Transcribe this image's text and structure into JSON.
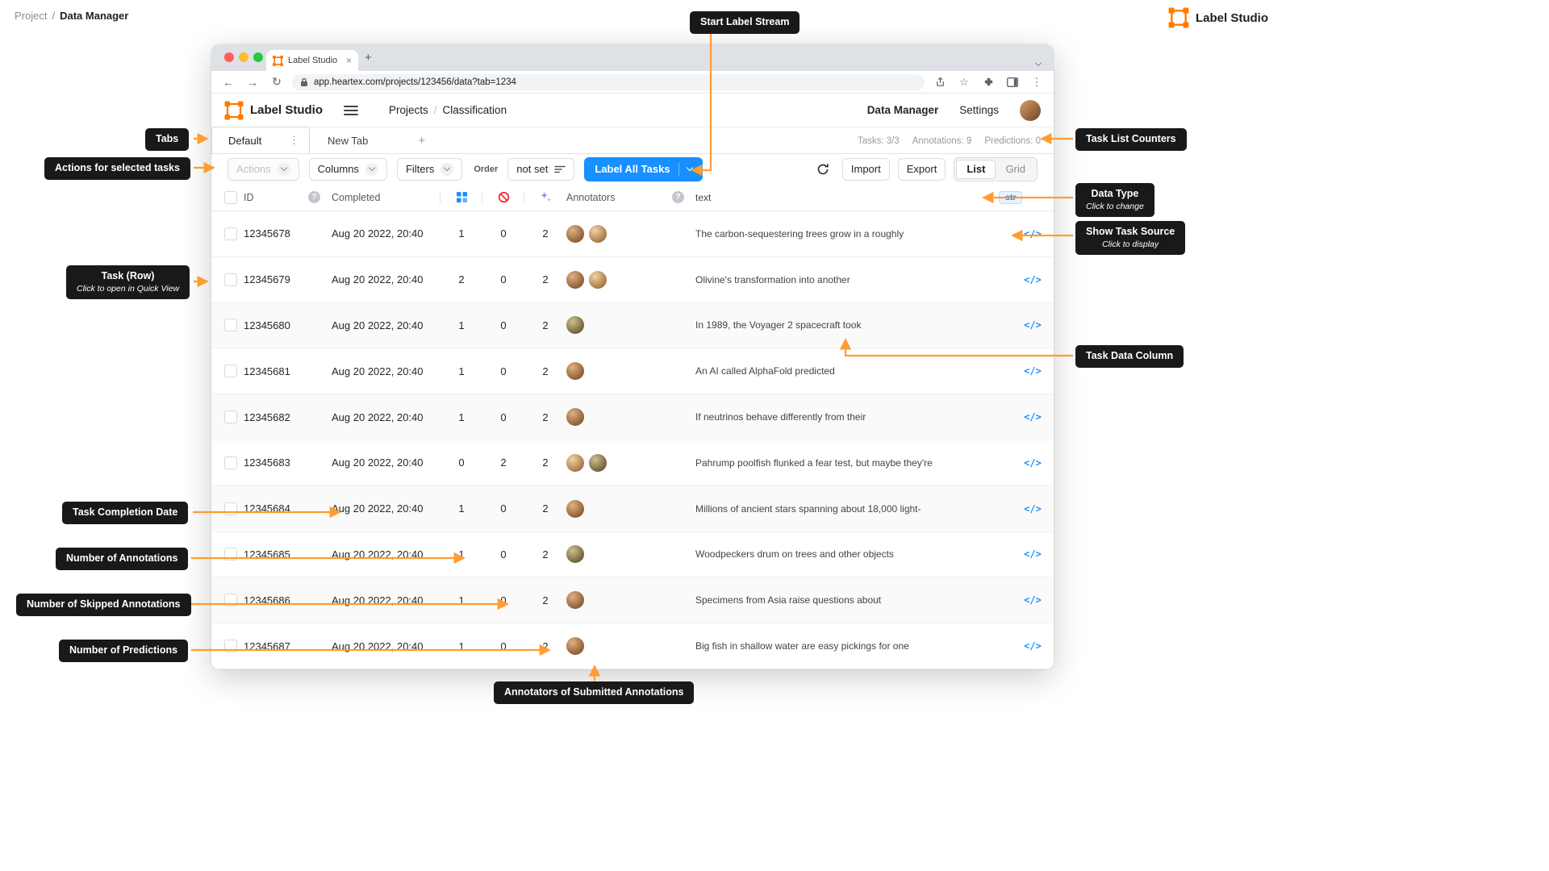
{
  "colors": {
    "accent_orange": "#FF9C32",
    "primary_blue": "#1890FF",
    "callout_bg": "#191919",
    "brand_orange": "#FF7A00"
  },
  "icons": {
    "kebab": "⋮",
    "plus": "+",
    "close": "×",
    "back": "←",
    "forward": "→",
    "reload": "↻",
    "star": "☆",
    "code": "</>",
    "question": "?"
  },
  "page": {
    "breadcrumb": {
      "root": "Project",
      "sep": "/",
      "current": "Data Manager"
    },
    "brand": "Label Studio"
  },
  "callouts": {
    "start_label_stream": "Start Label Stream",
    "tabs": "Tabs",
    "actions_for_selected": "Actions for selected tasks",
    "task_row": {
      "title": "Task (Row)",
      "sub": "Click to open in Quick View"
    },
    "task_completion_date": "Task Completion Date",
    "number_of_annotations": "Number of Annotations",
    "number_of_skipped": "Number of Skipped Annotations",
    "number_of_predictions": "Number of Predictions",
    "task_list_counters": "Task List Counters",
    "data_type": {
      "title": "Data Type",
      "sub": "Click to change"
    },
    "show_task_source": {
      "title": "Show Task Source",
      "sub": "Click to display"
    },
    "task_data_column": "Task Data Column",
    "annotators_submitted": "Annotators of Submitted Annotations"
  },
  "browser": {
    "tab_title": "Label Studio",
    "url": "app.heartex.com/projects/123456/data?tab=1234"
  },
  "app": {
    "brand": "Label Studio",
    "breadcrumb": {
      "root": "Projects",
      "sep": "/",
      "current": "Classification"
    },
    "nav": {
      "data_manager": "Data Manager",
      "settings": "Settings"
    },
    "tabs": {
      "active": "Default",
      "inactive": "New Tab"
    },
    "counters": {
      "tasks": "Tasks: 3/3",
      "annotations": "Annotations: 9",
      "predictions": "Predictions: 0"
    },
    "toolbar": {
      "actions": "Actions",
      "columns": "Columns",
      "filters": "Filters",
      "order_label": "Order",
      "order_value": "not set",
      "label_all_tasks": "Label All Tasks",
      "import": "Import",
      "export": "Export",
      "view_list": "List",
      "view_grid": "Grid"
    },
    "table": {
      "headers": {
        "id": "ID",
        "completed": "Completed",
        "annotators": "Annotators",
        "text": "text"
      },
      "data_type_badge": "str",
      "rows": [
        {
          "id": "12345678",
          "completed": "Aug 20 2022, 20:40",
          "annotations": "1",
          "skipped": "0",
          "predictions": "2",
          "annotators_count": 2,
          "text": "The carbon-sequestering trees grow in a roughly"
        },
        {
          "id": "12345679",
          "completed": "Aug 20 2022, 20:40",
          "annotations": "2",
          "skipped": "0",
          "predictions": "2",
          "annotators_count": 2,
          "text": "Olivine's transformation into another"
        },
        {
          "id": "12345680",
          "completed": "Aug 20 2022, 20:40",
          "annotations": "1",
          "skipped": "0",
          "predictions": "2",
          "annotators_count": 1,
          "text": "In 1989, the Voyager 2 spacecraft took"
        },
        {
          "id": "12345681",
          "completed": "Aug 20 2022, 20:40",
          "annotations": "1",
          "skipped": "0",
          "predictions": "2",
          "annotators_count": 1,
          "text": "An AI called AlphaFold predicted"
        },
        {
          "id": "12345682",
          "completed": "Aug 20 2022, 20:40",
          "annotations": "1",
          "skipped": "0",
          "predictions": "2",
          "annotators_count": 1,
          "text": "If neutrinos behave differently from their"
        },
        {
          "id": "12345683",
          "completed": "Aug 20 2022, 20:40",
          "annotations": "0",
          "skipped": "2",
          "predictions": "2",
          "annotators_count": 2,
          "text": "Pahrump poolfish flunked a fear test, but maybe they're"
        },
        {
          "id": "12345684",
          "completed": "Aug 20 2022, 20:40",
          "annotations": "1",
          "skipped": "0",
          "predictions": "2",
          "annotators_count": 1,
          "text": "Millions of ancient stars spanning about 18,000 light-"
        },
        {
          "id": "12345685",
          "completed": "Aug 20 2022, 20:40",
          "annotations": "1",
          "skipped": "0",
          "predictions": "2",
          "annotators_count": 1,
          "text": "Woodpeckers drum on trees and other objects"
        },
        {
          "id": "12345686",
          "completed": "Aug 20 2022, 20:40",
          "annotations": "1",
          "skipped": "0",
          "predictions": "2",
          "annotators_count": 1,
          "text": "Specimens from Asia raise questions about"
        },
        {
          "id": "12345687",
          "completed": "Aug 20 2022, 20:40",
          "annotations": "1",
          "skipped": "0",
          "predictions": "2",
          "annotators_count": 1,
          "text": "Big fish in shallow water are easy pickings for one"
        }
      ]
    }
  }
}
